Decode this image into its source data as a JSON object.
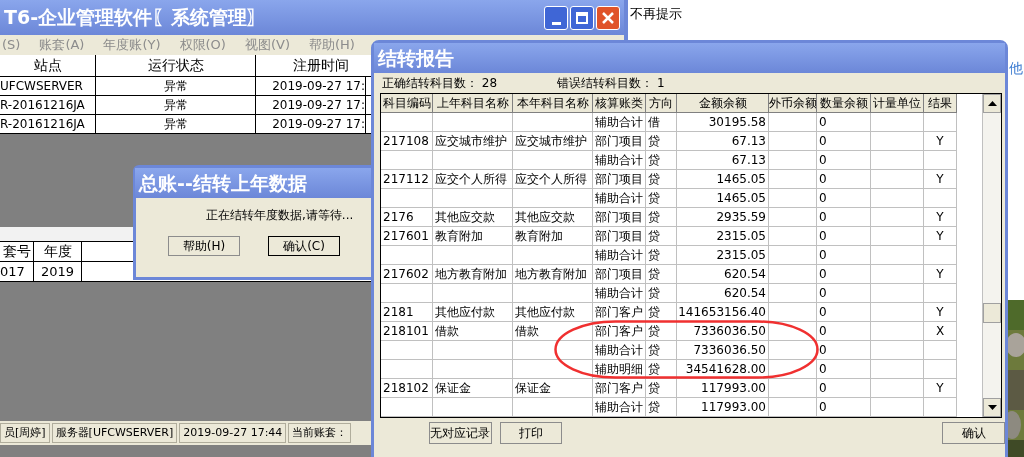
{
  "main_window": {
    "title": "T6-企业管理软件〖系统管理〗",
    "menu": [
      "(S)",
      "账套(A)",
      "年度账(Y)",
      "权限(O)",
      "视图(V)",
      "帮助(H)"
    ],
    "sites_table": {
      "columns": [
        "站点",
        "运行状态",
        "注册时间"
      ],
      "rows": [
        [
          "UFCWSERVER",
          "异常",
          "2019-09-27 17:"
        ],
        [
          "R-20161216JA",
          "异常",
          "2019-09-27 17:"
        ],
        [
          "R-20161216JA",
          "异常",
          "2019-09-27 17:"
        ]
      ]
    },
    "years_table": {
      "columns": [
        "套号",
        "年度"
      ],
      "rows": [
        [
          "017",
          "2019"
        ]
      ]
    },
    "status_bar": [
      "员[周婷]",
      "服务器[UFCWSERVER]",
      "2019-09-27 17:44",
      "当前账套："
    ]
  },
  "notice": "不再提示",
  "side_text": "他",
  "progress_dialog": {
    "title": "总账--结转上年数据",
    "message": "正在结转年度数据,请等待...",
    "buttons": [
      "帮助(H)",
      "确认(C)"
    ]
  },
  "report_dialog": {
    "title": "结转报告",
    "correct_label": "正确结转科目数：",
    "correct_count": "28",
    "error_label": "错误结转科目数：",
    "error_count": "1",
    "columns": [
      "科目编码",
      "上年科目名称",
      "本年科目名称",
      "核算账类",
      "方向",
      "金额余额",
      "外币余额",
      "数量余额",
      "计量单位",
      "结果"
    ],
    "rows": [
      [
        "",
        "",
        "",
        "辅助合计",
        "借",
        "30195.58",
        "",
        "0",
        "",
        ""
      ],
      [
        "217108",
        "应交城市维护",
        "应交城市维护",
        "部门项目",
        "贷",
        "67.13",
        "",
        "0",
        "",
        "Y"
      ],
      [
        "",
        "",
        "",
        "辅助合计",
        "贷",
        "67.13",
        "",
        "0",
        "",
        ""
      ],
      [
        "217112",
        "应交个人所得",
        "应交个人所得",
        "部门项目",
        "贷",
        "1465.05",
        "",
        "0",
        "",
        "Y"
      ],
      [
        "",
        "",
        "",
        "辅助合计",
        "贷",
        "1465.05",
        "",
        "0",
        "",
        ""
      ],
      [
        "2176",
        "其他应交款",
        "其他应交款",
        "部门项目",
        "贷",
        "2935.59",
        "",
        "0",
        "",
        "Y"
      ],
      [
        "217601",
        "教育附加",
        "教育附加",
        "部门项目",
        "贷",
        "2315.05",
        "",
        "0",
        "",
        "Y"
      ],
      [
        "",
        "",
        "",
        "辅助合计",
        "贷",
        "2315.05",
        "",
        "0",
        "",
        ""
      ],
      [
        "217602",
        "地方教育附加",
        "地方教育附加",
        "部门项目",
        "贷",
        "620.54",
        "",
        "0",
        "",
        "Y"
      ],
      [
        "",
        "",
        "",
        "辅助合计",
        "贷",
        "620.54",
        "",
        "0",
        "",
        ""
      ],
      [
        "2181",
        "其他应付款",
        "其他应付款",
        "部门客户",
        "贷",
        "141653156.40",
        "",
        "0",
        "",
        "Y"
      ],
      [
        "218101",
        "借款",
        "借款",
        "部门客户",
        "贷",
        "7336036.50",
        "",
        "0",
        "",
        "X"
      ],
      [
        "",
        "",
        "",
        "辅助合计",
        "贷",
        "7336036.50",
        "",
        "0",
        "",
        ""
      ],
      [
        "",
        "",
        "",
        "辅助明细",
        "贷",
        "34541628.00",
        "",
        "0",
        "",
        ""
      ],
      [
        "218102",
        "保证金",
        "保证金",
        "部门客户",
        "贷",
        "117993.00",
        "",
        "0",
        "",
        "Y"
      ],
      [
        "",
        "",
        "",
        "辅助合计",
        "贷",
        "117993.00",
        "",
        "0",
        "",
        ""
      ]
    ],
    "buttons": [
      "无对应记录",
      "打印",
      "确认"
    ]
  }
}
